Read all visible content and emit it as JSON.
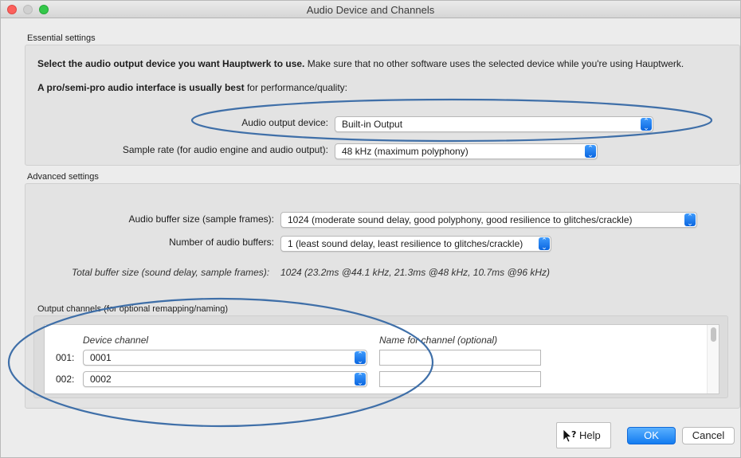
{
  "window": {
    "title": "Audio Device and Channels"
  },
  "essential": {
    "section_label": "Essential settings",
    "intro_bold": "Select the audio output device you want Hauptwerk to use.",
    "intro_rest": " Make sure that no other software uses the selected device while you're using Hauptwerk.",
    "tip_bold": "A pro/semi-pro audio interface is usually best",
    "tip_rest": " for performance/quality:",
    "output_device_label": "Audio output device:",
    "output_device_value": "Built-in Output",
    "sample_rate_label": "Sample rate (for audio engine and audio output):",
    "sample_rate_value": "48 kHz (maximum polyphony)"
  },
  "advanced": {
    "section_label": "Advanced settings",
    "buffer_size_label": "Audio buffer size (sample frames):",
    "buffer_size_value": "1024 (moderate sound delay, good polyphony, good resilience to glitches/crackle)",
    "num_buffers_label": "Number of audio buffers:",
    "num_buffers_value": "1 (least sound delay, least resilience to glitches/crackle)",
    "total_label": "Total buffer size (sound delay, sample frames):",
    "total_value": "1024 (23.2ms @44.1 kHz, 21.3ms @48 kHz, 10.7ms @96 kHz)"
  },
  "channels": {
    "section_label": "Output channels (for optional remapping/naming)",
    "col_device": "Device channel",
    "col_name": "Name for channel (optional)",
    "rows": [
      {
        "index": "001:",
        "device": "0001",
        "name": ""
      },
      {
        "index": "002:",
        "device": "0002",
        "name": ""
      }
    ]
  },
  "buttons": {
    "help": "Help",
    "ok": "OK",
    "cancel": "Cancel"
  },
  "colors": {
    "accent": "#137cf0",
    "annotation": "#3f6fa8"
  },
  "icons": {
    "help": "help-cursor-icon",
    "stepper": "up-down-chevron-icon"
  }
}
